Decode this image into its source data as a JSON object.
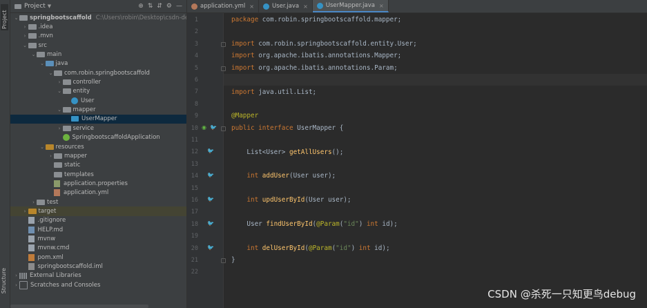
{
  "side_strip": {
    "project_label": "Project",
    "structure_label": "Structure"
  },
  "panel": {
    "title": "Project",
    "tree": [
      {
        "label": "springbootscaffold",
        "path": "C:\\Users\\robin\\Desktop\\csdn-demo\\s",
        "depth": 0,
        "arrow": "open",
        "icon": "folder",
        "bold": true
      },
      {
        "label": ".idea",
        "depth": 1,
        "arrow": "closed",
        "icon": "folder"
      },
      {
        "label": ".mvn",
        "depth": 1,
        "arrow": "closed",
        "icon": "folder"
      },
      {
        "label": "src",
        "depth": 1,
        "arrow": "open",
        "icon": "folder"
      },
      {
        "label": "main",
        "depth": 2,
        "arrow": "open",
        "icon": "folder"
      },
      {
        "label": "java",
        "depth": 3,
        "arrow": "open",
        "icon": "folder-blue"
      },
      {
        "label": "com.robin.springbootscaffold",
        "depth": 4,
        "arrow": "open",
        "icon": "package"
      },
      {
        "label": "controller",
        "depth": 5,
        "arrow": "closed",
        "icon": "package"
      },
      {
        "label": "entity",
        "depth": 5,
        "arrow": "open",
        "icon": "package"
      },
      {
        "label": "User",
        "depth": 6,
        "arrow": "none",
        "icon": "class"
      },
      {
        "label": "mapper",
        "depth": 5,
        "arrow": "open",
        "icon": "package"
      },
      {
        "label": "UserMapper",
        "depth": 6,
        "arrow": "none",
        "icon": "mapper",
        "selected": true
      },
      {
        "label": "service",
        "depth": 5,
        "arrow": "closed",
        "icon": "package"
      },
      {
        "label": "SpringbootscaffoldApplication",
        "depth": 5,
        "arrow": "none",
        "icon": "spring"
      },
      {
        "label": "resources",
        "depth": 3,
        "arrow": "open",
        "icon": "folder-orange"
      },
      {
        "label": "mapper",
        "depth": 4,
        "arrow": "closed",
        "icon": "folder"
      },
      {
        "label": "static",
        "depth": 4,
        "arrow": "none",
        "icon": "folder"
      },
      {
        "label": "templates",
        "depth": 4,
        "arrow": "none",
        "icon": "folder"
      },
      {
        "label": "application.properties",
        "depth": 4,
        "arrow": "none",
        "icon": "file-props"
      },
      {
        "label": "application.yml",
        "depth": 4,
        "arrow": "none",
        "icon": "file-yml"
      },
      {
        "label": "test",
        "depth": 2,
        "arrow": "closed",
        "icon": "folder"
      },
      {
        "label": "target",
        "depth": 1,
        "arrow": "closed",
        "icon": "folder-orange",
        "target": true
      },
      {
        "label": ".gitignore",
        "depth": 1,
        "arrow": "none",
        "icon": "file"
      },
      {
        "label": "HELP.md",
        "depth": 1,
        "arrow": "none",
        "icon": "file-md"
      },
      {
        "label": "mvnw",
        "depth": 1,
        "arrow": "none",
        "icon": "file"
      },
      {
        "label": "mvnw.cmd",
        "depth": 1,
        "arrow": "none",
        "icon": "file"
      },
      {
        "label": "pom.xml",
        "depth": 1,
        "arrow": "none",
        "icon": "file-xml"
      },
      {
        "label": "springbootscaffold.iml",
        "depth": 1,
        "arrow": "none",
        "icon": "file-iml"
      },
      {
        "label": "External Libraries",
        "depth": 0,
        "arrow": "closed",
        "icon": "library"
      },
      {
        "label": "Scratches and Consoles",
        "depth": 0,
        "arrow": "closed",
        "icon": "scratch"
      }
    ]
  },
  "tabs": [
    {
      "label": "application.yml",
      "icon_color": "#b4785a",
      "active": false
    },
    {
      "label": "User.java",
      "icon_color": "#3592c4",
      "active": false
    },
    {
      "label": "UserMapper.java",
      "icon_color": "#3592c4",
      "active": true
    }
  ],
  "code_lines": [
    {
      "n": "1",
      "tokens": [
        [
          "kw",
          "package "
        ],
        [
          "t",
          "com.robin.springbootscaffold.mapper;"
        ]
      ]
    },
    {
      "n": "2",
      "tokens": []
    },
    {
      "n": "3",
      "tokens": [
        [
          "kw",
          "import "
        ],
        [
          "t",
          "com.robin.springbootscaffold.entity.User;"
        ]
      ]
    },
    {
      "n": "4",
      "tokens": [
        [
          "kw",
          "import "
        ],
        [
          "t",
          "org.apache.ibatis.annotations.Mapper;"
        ]
      ]
    },
    {
      "n": "5",
      "tokens": [
        [
          "kw",
          "import "
        ],
        [
          "t",
          "org.apache.ibatis.annotations.Param;"
        ]
      ]
    },
    {
      "n": "6",
      "tokens": [],
      "current": true
    },
    {
      "n": "7",
      "tokens": [
        [
          "kw",
          "import "
        ],
        [
          "t",
          "java.util.List;"
        ]
      ]
    },
    {
      "n": "8",
      "tokens": []
    },
    {
      "n": "9",
      "tokens": [
        [
          "ann",
          "@Mapper"
        ]
      ]
    },
    {
      "n": "10",
      "tokens": [
        [
          "kw",
          "public interface "
        ],
        [
          "t",
          "UserMapper {"
        ]
      ]
    },
    {
      "n": "11",
      "tokens": []
    },
    {
      "n": "12",
      "tokens": [
        [
          "t",
          "    List<"
        ],
        [
          "t",
          "User"
        ],
        [
          "t",
          "> "
        ],
        [
          "fn",
          "getAllUsers"
        ],
        [
          "t",
          "();"
        ]
      ]
    },
    {
      "n": "13",
      "tokens": []
    },
    {
      "n": "14",
      "tokens": [
        [
          "kw",
          "    int "
        ],
        [
          "fn",
          "addUser"
        ],
        [
          "t",
          "(User user);"
        ]
      ]
    },
    {
      "n": "15",
      "tokens": []
    },
    {
      "n": "16",
      "tokens": [
        [
          "kw",
          "    int "
        ],
        [
          "fn",
          "updUserById"
        ],
        [
          "t",
          "(User user);"
        ]
      ]
    },
    {
      "n": "17",
      "tokens": []
    },
    {
      "n": "18",
      "tokens": [
        [
          "t",
          "    User "
        ],
        [
          "fn",
          "findUserById"
        ],
        [
          "t",
          "("
        ],
        [
          "ann",
          "@Param"
        ],
        [
          "t",
          "("
        ],
        [
          "str",
          "\"id\""
        ],
        [
          "t",
          ") "
        ],
        [
          "kw",
          "int "
        ],
        [
          "t",
          "id);"
        ]
      ]
    },
    {
      "n": "19",
      "tokens": []
    },
    {
      "n": "20",
      "tokens": [
        [
          "kw",
          "    int "
        ],
        [
          "fn",
          "delUserById"
        ],
        [
          "t",
          "("
        ],
        [
          "ann",
          "@Param"
        ],
        [
          "t",
          "("
        ],
        [
          "str",
          "\"id\""
        ],
        [
          "t",
          ") "
        ],
        [
          "kw",
          "int "
        ],
        [
          "t",
          "id);"
        ]
      ]
    },
    {
      "n": "21",
      "tokens": [
        [
          "t",
          "}"
        ]
      ]
    },
    {
      "n": "22",
      "tokens": []
    }
  ],
  "gutter_icons": [
    {
      "line": "10",
      "icons": [
        "implement-icon",
        "mybatis-bird-icon"
      ]
    },
    {
      "line": "12",
      "icons": [
        "mybatis-bird-icon"
      ]
    },
    {
      "line": "14",
      "icons": [
        "mybatis-bird-icon"
      ]
    },
    {
      "line": "16",
      "icons": [
        "mybatis-bird-icon"
      ]
    },
    {
      "line": "18",
      "icons": [
        "mybatis-bird-icon"
      ]
    },
    {
      "line": "20",
      "icons": [
        "mybatis-bird-icon"
      ]
    }
  ],
  "watermark": "CSDN @杀死一只知更鸟debug"
}
